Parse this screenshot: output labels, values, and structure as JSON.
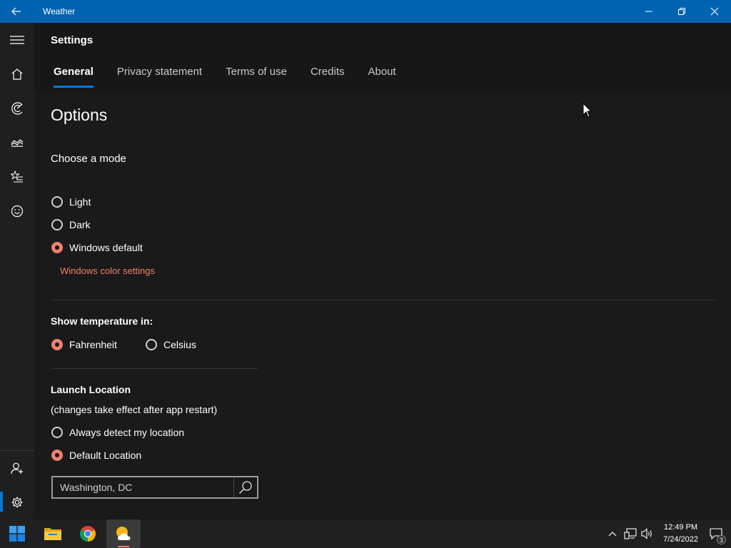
{
  "window": {
    "title": "Weather"
  },
  "header": {
    "title": "Settings",
    "tabs": [
      {
        "label": "General",
        "active": true
      },
      {
        "label": "Privacy statement",
        "active": false
      },
      {
        "label": "Terms of use",
        "active": false
      },
      {
        "label": "Credits",
        "active": false
      },
      {
        "label": "About",
        "active": false
      }
    ]
  },
  "nav": {
    "icons": [
      "hamburger-icon",
      "home-icon",
      "radar-icon",
      "historical-weather-icon",
      "favorites-icon",
      "smiley-icon",
      "account-icon",
      "settings-icon"
    ]
  },
  "options": {
    "heading": "Options",
    "mode": {
      "label": "Choose a mode",
      "choices": [
        "Light",
        "Dark",
        "Windows default"
      ],
      "selected": "Windows default",
      "link": "Windows color settings"
    },
    "temperature": {
      "label": "Show temperature in:",
      "choices": [
        "Fahrenheit",
        "Celsius"
      ],
      "selected": "Fahrenheit"
    },
    "launch": {
      "label": "Launch Location",
      "note": "(changes take effect after app restart)",
      "choices": [
        "Always detect my location",
        "Default Location"
      ],
      "selected": "Default Location",
      "location_value": "Washington, DC"
    }
  },
  "taskbar": {
    "time": "12:49 PM",
    "date": "7/24/2022",
    "notification_count": "3"
  },
  "colors": {
    "titlebar": "#0063b1",
    "accent": "#0078d7",
    "radio_accent": "#f0806e"
  }
}
